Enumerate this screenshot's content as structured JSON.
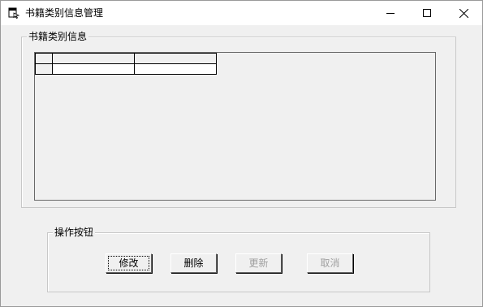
{
  "window": {
    "title": "书籍类别信息管理",
    "icon": "form-icon"
  },
  "info_group": {
    "legend": "书籍类别信息"
  },
  "grid": {
    "columns": [
      "",
      ""
    ],
    "rows": [
      [
        "",
        ""
      ]
    ]
  },
  "ops_group": {
    "legend": "操作按钮",
    "buttons": {
      "modify": "修改",
      "delete": "删除",
      "update": "更新",
      "cancel": "取消"
    }
  }
}
